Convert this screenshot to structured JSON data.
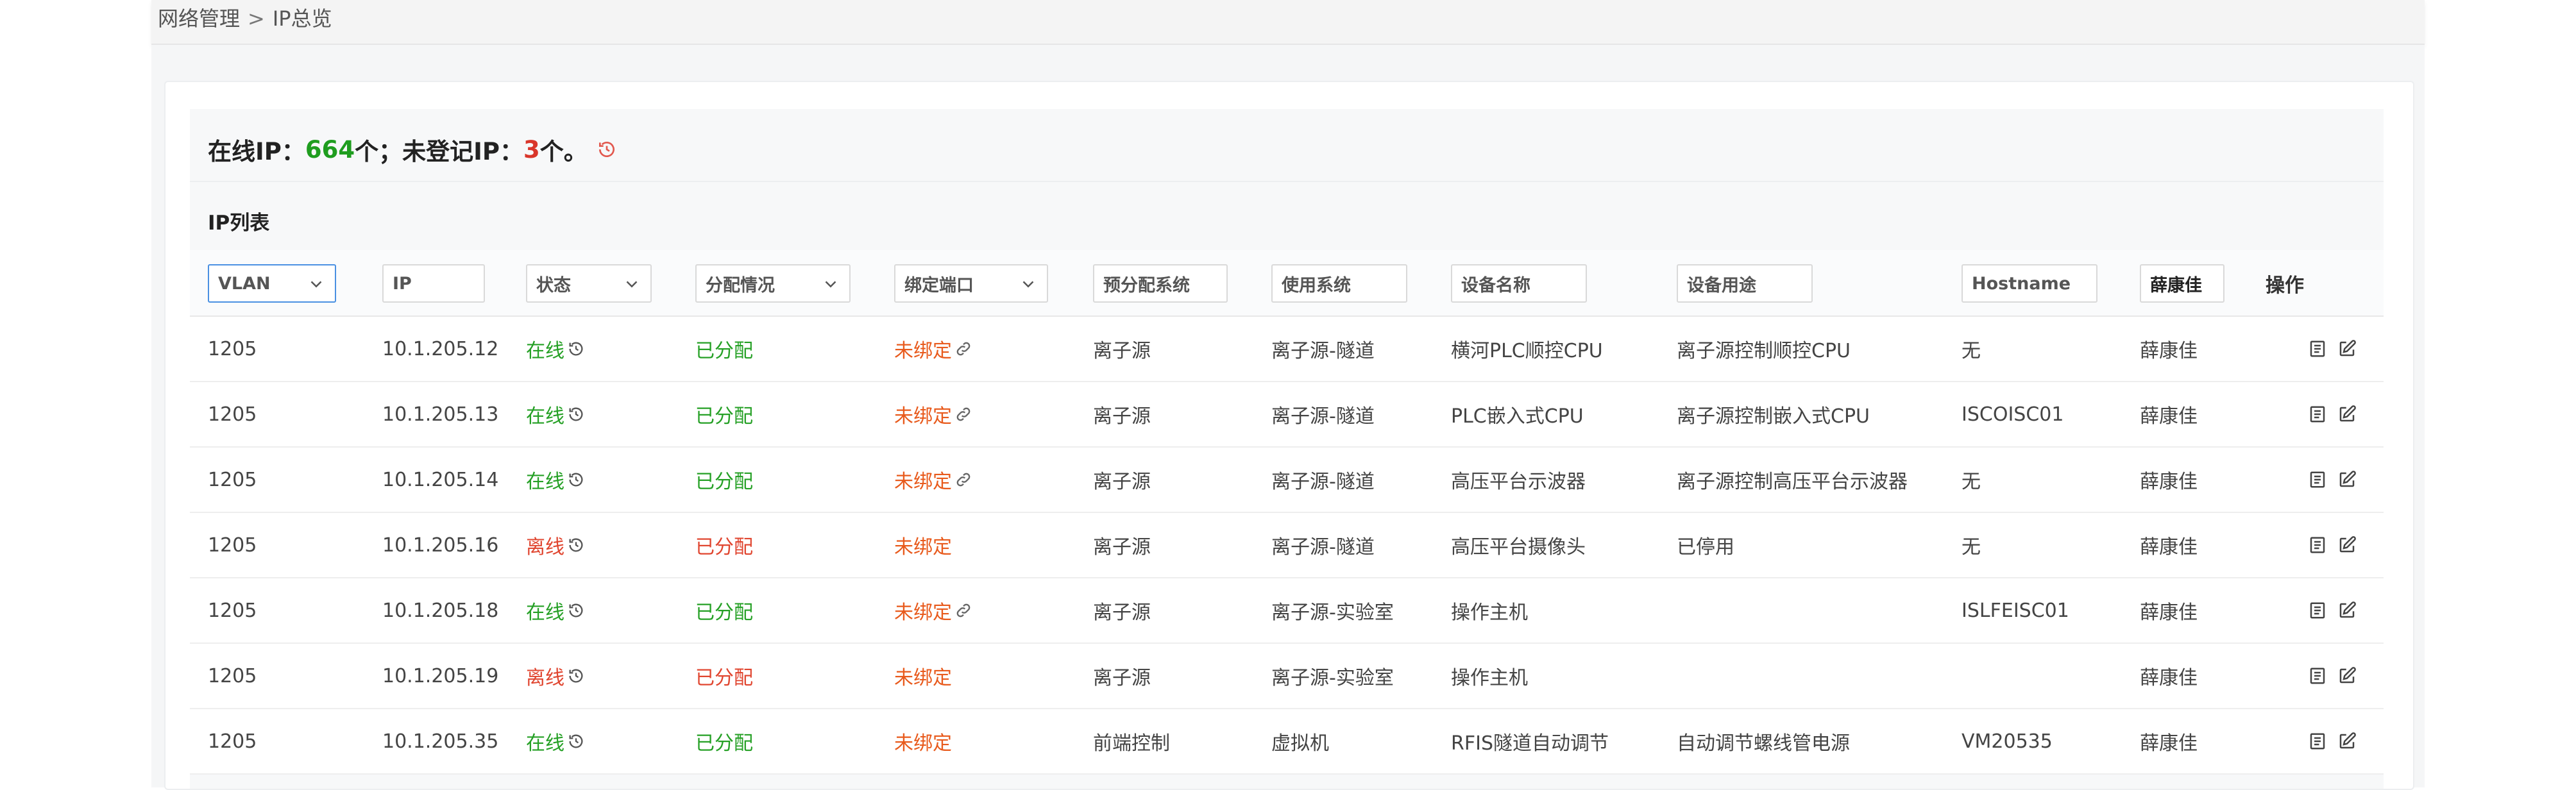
{
  "breadcrumb": {
    "parent": "网络管理",
    "separator": ">",
    "current": "IP总览"
  },
  "summary": {
    "online_label": "在线IP：",
    "online_count": "664",
    "online_unit": "个；",
    "unregistered_label": "未登记IP：",
    "unregistered_count": "3",
    "unregistered_unit": "个。"
  },
  "list_title": "IP列表",
  "filters": {
    "vlan": "VLAN",
    "ip": "IP",
    "status": "状态",
    "allocation": "分配情况",
    "bound_port": "绑定端口",
    "pre_system": "预分配系统",
    "use_system": "使用系统",
    "device_name": "设备名称",
    "device_usage": "设备用途",
    "hostname": "Hostname",
    "owner": "薛康佳",
    "actions": "操作"
  },
  "rows": [
    {
      "vlan": "1205",
      "ip": "10.1.205.12",
      "status": "在线",
      "status_type": "online",
      "alloc": "已分配",
      "port": "未绑定",
      "port_linked": true,
      "pre": "离子源",
      "use": "离子源-隧道",
      "device": "横河PLC顺控CPU",
      "usage": "离子源控制顺控CPU",
      "hostname": "无",
      "owner": "薛康佳"
    },
    {
      "vlan": "1205",
      "ip": "10.1.205.13",
      "status": "在线",
      "status_type": "online",
      "alloc": "已分配",
      "port": "未绑定",
      "port_linked": true,
      "pre": "离子源",
      "use": "离子源-隧道",
      "device": "PLC嵌入式CPU",
      "usage": "离子源控制嵌入式CPU",
      "hostname": "ISCOISC01",
      "owner": "薛康佳"
    },
    {
      "vlan": "1205",
      "ip": "10.1.205.14",
      "status": "在线",
      "status_type": "online",
      "alloc": "已分配",
      "port": "未绑定",
      "port_linked": true,
      "pre": "离子源",
      "use": "离子源-隧道",
      "device": "高压平台示波器",
      "usage": "离子源控制高压平台示波器",
      "hostname": "无",
      "owner": "薛康佳"
    },
    {
      "vlan": "1205",
      "ip": "10.1.205.16",
      "status": "离线",
      "status_type": "offline",
      "alloc": "已分配",
      "port": "未绑定",
      "port_linked": false,
      "pre": "离子源",
      "use": "离子源-隧道",
      "device": "高压平台摄像头",
      "usage": "已停用",
      "hostname": "无",
      "owner": "薛康佳"
    },
    {
      "vlan": "1205",
      "ip": "10.1.205.18",
      "status": "在线",
      "status_type": "online",
      "alloc": "已分配",
      "port": "未绑定",
      "port_linked": true,
      "pre": "离子源",
      "use": "离子源-实验室",
      "device": "操作主机",
      "usage": "",
      "hostname": "ISLFEISC01",
      "owner": "薛康佳"
    },
    {
      "vlan": "1205",
      "ip": "10.1.205.19",
      "status": "离线",
      "status_type": "offline",
      "alloc": "已分配",
      "port": "未绑定",
      "port_linked": false,
      "pre": "离子源",
      "use": "离子源-实验室",
      "device": "操作主机",
      "usage": "",
      "hostname": "",
      "owner": "薛康佳"
    },
    {
      "vlan": "1205",
      "ip": "10.1.205.35",
      "status": "在线",
      "status_type": "online",
      "alloc": "已分配",
      "port": "未绑定",
      "port_linked": false,
      "pre": "前端控制",
      "use": "虚拟机",
      "device": "RFIS隧道自动调节",
      "usage": "自动调节螺线管电源",
      "hostname": "VM20535",
      "owner": "薛康佳"
    }
  ],
  "colors": {
    "online": "#25a025",
    "offline": "#e0452f",
    "allocated_offline": "#e0452f",
    "unbound": "#e85a1c",
    "accent": "#4a90e2"
  },
  "icons": {
    "history": "history-icon",
    "link": "link-icon",
    "detail": "list-detail-icon",
    "edit": "edit-icon",
    "dropdown": "chevron-down-icon"
  }
}
